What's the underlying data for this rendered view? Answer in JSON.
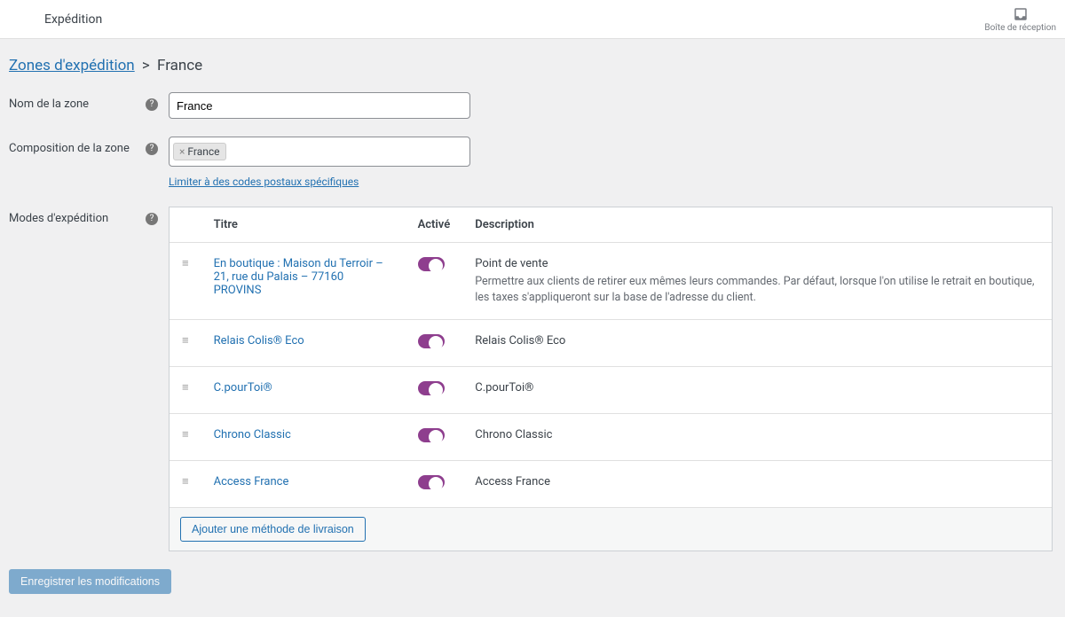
{
  "topbar": {
    "title": "Expédition",
    "inbox_label": "Boîte de réception"
  },
  "breadcrumb": {
    "root": "Zones d'expédition",
    "separator": ">",
    "current": "France"
  },
  "zone_name": {
    "label": "Nom de la zone",
    "value": "France"
  },
  "zone_region": {
    "label": "Composition de la zone",
    "tag": "France",
    "limit_link": "Limiter à des codes postaux spécifiques"
  },
  "methods": {
    "label": "Modes d'expédition",
    "headers": {
      "title": "Titre",
      "enabled": "Activé",
      "description": "Description"
    },
    "rows": [
      {
        "title": "En boutique : Maison du Terroir – 21, rue du Palais – 77160 PROVINS",
        "desc_title": "Point de vente",
        "desc_sub": "Permettre aux clients de retirer eux mêmes leurs commandes. Par défaut, lorsque l'on utilise le retrait en boutique, les taxes s'appliqueront sur la base de l'adresse du client."
      },
      {
        "title": "Relais Colis® Eco",
        "desc_title": "Relais Colis® Eco",
        "desc_sub": ""
      },
      {
        "title": "C.pourToi®",
        "desc_title": "C.pourToi®",
        "desc_sub": ""
      },
      {
        "title": "Chrono Classic",
        "desc_title": "Chrono Classic",
        "desc_sub": ""
      },
      {
        "title": "Access France",
        "desc_title": "Access France",
        "desc_sub": ""
      }
    ],
    "add_button": "Ajouter une méthode de livraison"
  },
  "save_button": "Enregistrer les modifications"
}
